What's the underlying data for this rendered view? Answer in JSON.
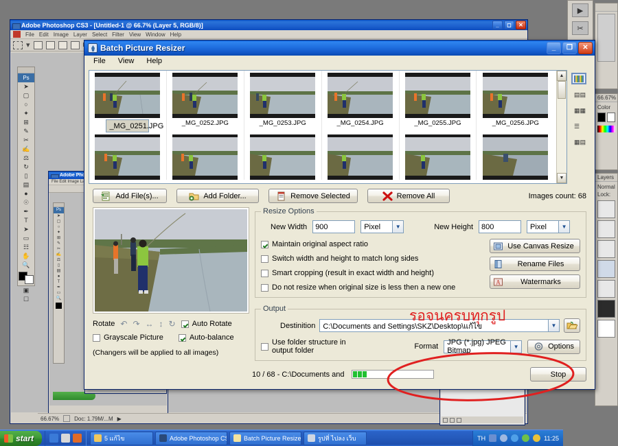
{
  "desktop": {
    "photoshop": {
      "title": "Adobe Photoshop CS3 - [Untitled-1 @ 66.7% (Layer 5, RGB/8)]",
      "menus": [
        "File",
        "Edit",
        "Image",
        "Layer",
        "Select",
        "Filter",
        "View",
        "Window",
        "Help"
      ],
      "zoom_status": "66.67%",
      "doc_status": "Doc: 1.79M/...M",
      "panels": [
        {
          "label": "Color"
        },
        {
          "label": "Layers"
        },
        {
          "label": "Normal"
        },
        {
          "label": "Lock:"
        }
      ],
      "nested_title": "Adobe Photoshop ..."
    }
  },
  "app": {
    "title": "Batch Picture Resizer",
    "icon": "app-diamond-icon",
    "window_buttons": {
      "minimize": "_",
      "maximize": "❐",
      "close": "✕"
    },
    "menu": [
      "File",
      "View",
      "Help"
    ]
  },
  "thumbnails": {
    "row1": [
      {
        "name": "_MG_0251.JPG",
        "selected": true
      },
      {
        "name": "_MG_0252.JPG",
        "selected": false
      },
      {
        "name": "_MG_0253.JPG",
        "selected": false
      },
      {
        "name": "_MG_0254.JPG",
        "selected": false
      },
      {
        "name": "_MG_0255.JPG",
        "selected": false
      },
      {
        "name": "_MG_0256.JPG",
        "selected": false
      }
    ],
    "scroll": {
      "up": "▲",
      "down": "▼"
    },
    "view_modes": [
      "thumbnails-view-icon",
      "tiles-view-icon",
      "icons-view-icon",
      "list-view-icon",
      "details-view-icon"
    ]
  },
  "filebar": {
    "add_files": "Add File(s)...",
    "add_folder": "Add Folder...",
    "remove_selected": "Remove Selected",
    "remove_all": "Remove All",
    "images_count": "Images count: 68"
  },
  "preview": {
    "rotate_label": "Rotate",
    "auto_rotate": "Auto Rotate",
    "auto_rotate_checked": true,
    "grayscale": "Grayscale Picture",
    "grayscale_checked": false,
    "auto_balance": "Auto-balance",
    "auto_balance_checked": true,
    "note": "(Changers will be applied to all images)"
  },
  "resize": {
    "legend": "Resize Options",
    "width_label": "New Width",
    "width_value": "900",
    "width_unit": "Pixel",
    "height_label": "New Height",
    "height_value": "800",
    "height_unit": "Pixel",
    "options": [
      {
        "label": "Maintain original aspect ratio",
        "checked": true
      },
      {
        "label": "Switch width and height to match long sides",
        "checked": false
      },
      {
        "label": "Smart cropping (result in exact width and height)",
        "checked": false
      },
      {
        "label": "Do not resize when original size is less then a new one",
        "checked": false
      }
    ],
    "buttons": [
      {
        "label": "Use Canvas Resize",
        "icon": "canvas-resize-icon"
      },
      {
        "label": "Rename Files",
        "icon": "rename-files-icon"
      },
      {
        "label": "Watermarks",
        "icon": "watermark-icon"
      }
    ]
  },
  "output": {
    "legend": "Output",
    "destination_label": "Destinition",
    "destination_value": "C:\\Documents and Settings\\SKZ\\Desktop\\แก้ไข",
    "use_folder_structure": "Use folder structure in output folder",
    "use_folder_structure_checked": false,
    "format_label": "Format",
    "format_value": "JPG (*.jpg) JPEG Bitmap",
    "options_button": "Options",
    "browse_icon": "folder-open-icon"
  },
  "status": {
    "progress_text": "10 / 68 - C:\\Documents and",
    "progress_blocks": 3,
    "stop_button": "Stop"
  },
  "annotation": {
    "thai_note": "รอจนครบทุกรูป",
    "color": "#e02020",
    "ellipse": "red-ellipse-highlight"
  },
  "taskbar": {
    "start": "start",
    "tasks": [
      {
        "label": "5 แก้ไข",
        "icon": "folder-icon"
      },
      {
        "label": "Adobe Photoshop CS ...",
        "icon": "photoshop-icon"
      },
      {
        "label": "Batch Picture Resizer ...",
        "icon": "bpr-icon"
      },
      {
        "label": "รูปที่ ไปลง เว็บ",
        "icon": "app-icon"
      }
    ],
    "lang": "TH",
    "clock": "11:25"
  }
}
